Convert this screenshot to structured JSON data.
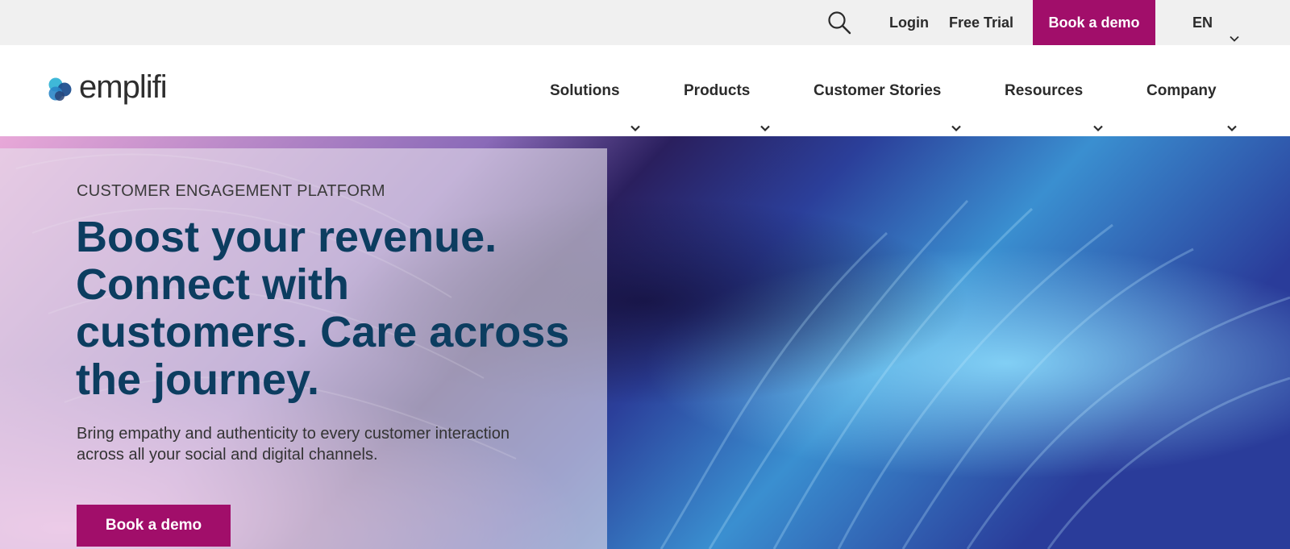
{
  "utility_bar": {
    "search_icon": "search-icon",
    "login_label": "Login",
    "free_trial_label": "Free Trial",
    "book_demo_label": "Book a demo",
    "language": "EN"
  },
  "header": {
    "logo_text": "emplifi",
    "nav": [
      {
        "label": "Solutions"
      },
      {
        "label": "Products"
      },
      {
        "label": "Customer Stories"
      },
      {
        "label": "Resources"
      },
      {
        "label": "Company"
      }
    ]
  },
  "hero": {
    "eyebrow": "CUSTOMER ENGAGEMENT PLATFORM",
    "title": "Boost your revenue. Connect with customers. Care across the journey.",
    "subtitle": "Bring empathy and authenticity to every customer interaction across all your social and digital channels.",
    "cta_label": "Book a demo"
  },
  "colors": {
    "brand_accent": "#a10e6a",
    "headline": "#0c3d60",
    "utility_bg": "#f0f0f0"
  }
}
